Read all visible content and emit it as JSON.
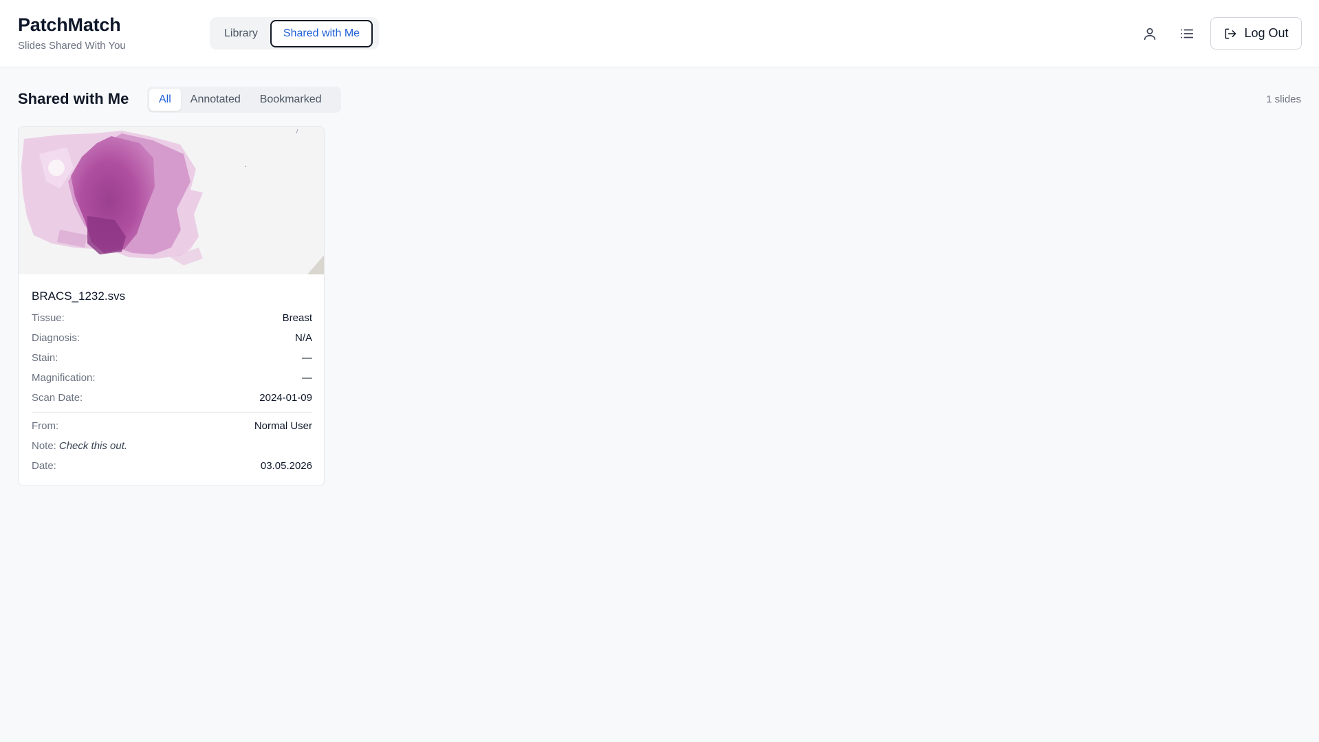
{
  "header": {
    "title": "PatchMatch",
    "subtitle": "Slides Shared With You",
    "nav_tabs": [
      {
        "label": "Library",
        "active": false
      },
      {
        "label": "Shared with Me",
        "active": true
      }
    ],
    "icons": [
      "user-icon",
      "list-icon"
    ],
    "logout_label": "Log Out",
    "accent_color": "#1d5fd6"
  },
  "toolbar": {
    "section_title": "Shared with Me",
    "filters": [
      {
        "label": "All",
        "active": true
      },
      {
        "label": "Annotated",
        "active": false
      },
      {
        "label": "Bookmarked",
        "active": false
      }
    ],
    "count": "1 slides"
  },
  "slides": [
    {
      "filename": "BRACS_1232.svs",
      "fields": [
        {
          "key": "Tissue:",
          "value": "Breast"
        },
        {
          "key": "Diagnosis:",
          "value": "N/A"
        },
        {
          "key": "Stain:",
          "value": "—"
        },
        {
          "key": "Magnification:",
          "value": "—"
        },
        {
          "key": "Scan Date:",
          "value": "2024-01-09"
        }
      ],
      "share": {
        "from_label": "From:",
        "from_value": "Normal User",
        "note_label": "Note:",
        "note_value": "Check this out.",
        "date_label": "Date:",
        "date_value": "03.05.2026"
      }
    }
  ]
}
